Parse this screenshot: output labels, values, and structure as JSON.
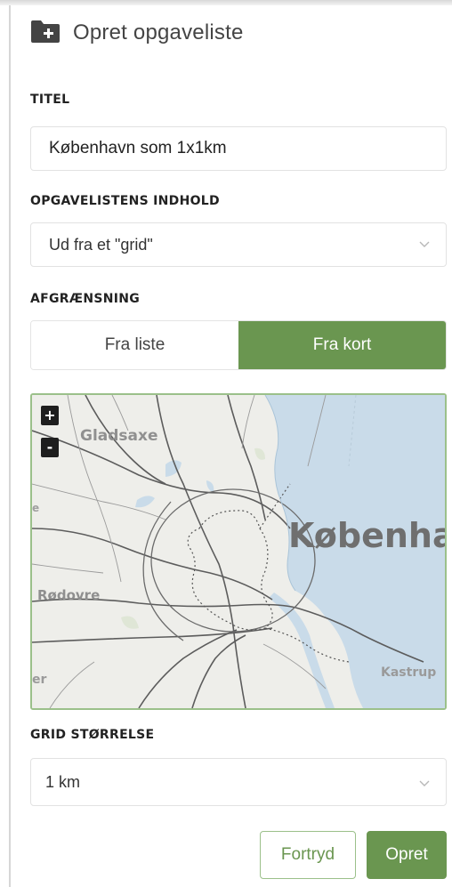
{
  "header": {
    "title": "Opret opgaveliste",
    "icon": "folder-plus-icon"
  },
  "titel": {
    "label": "TITEL",
    "value": "København som 1x1km"
  },
  "indhold": {
    "label": "OPGAVELISTENS INDHOLD",
    "value": "Ud fra et \"grid\""
  },
  "afgraensning": {
    "label": "AFGRÆNSNING",
    "options": [
      "Fra liste",
      "Fra kort"
    ],
    "selected": "Fra kort"
  },
  "map": {
    "zoom_in": "+",
    "zoom_out": "-",
    "labels": {
      "gladsaxe": "Gladsaxe",
      "kobenhavn": "Københav",
      "rodovre": "Rødovre",
      "er": "er",
      "kastrup": "Kastrup",
      "e": "e"
    }
  },
  "grid_size": {
    "label": "GRID STØRRELSE",
    "value": "1 km"
  },
  "actions": {
    "cancel": "Fortryd",
    "create": "Opret"
  },
  "colors": {
    "accent": "#6a9650",
    "accent_border": "#9bc08a",
    "water": "#c9dbe9",
    "land": "#eeeeea"
  }
}
